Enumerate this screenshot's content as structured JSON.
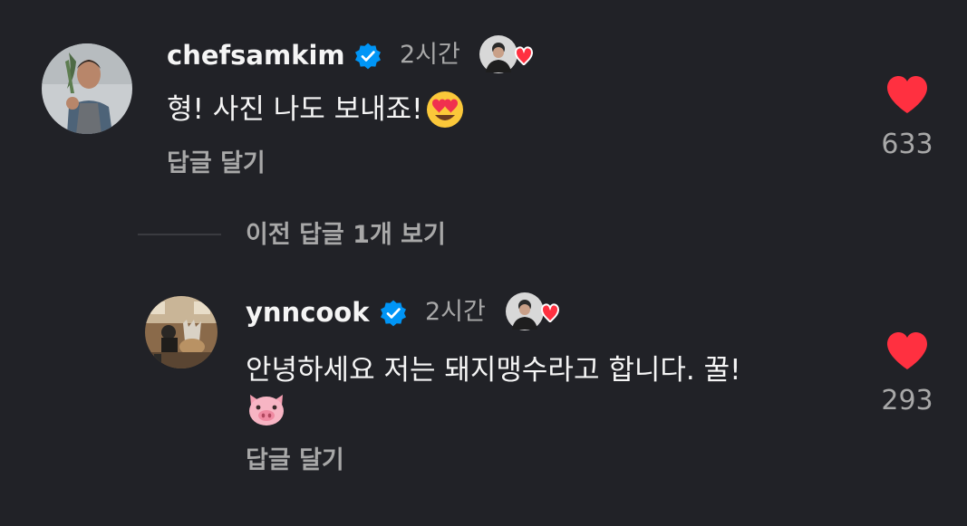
{
  "comments": [
    {
      "username": "chefsamkim",
      "verified": true,
      "time": "2시간",
      "text": "형! 사진 나도 보내죠!",
      "text_emoji": "heart-eyes-emoji",
      "reply_label": "답글 달기",
      "like_count": "633"
    },
    {
      "username": "ynncook",
      "verified": true,
      "time": "2시간",
      "text": "안녕하세요 저는 돼지맹수라고 합니다. 꿀!",
      "text_emoji": "pig-face-emoji",
      "reply_label": "답글 달기",
      "like_count": "293"
    }
  ],
  "view_previous_replies": "이전 답글 1개 보기",
  "colors": {
    "background": "#212227",
    "text_primary": "#f5f5f5",
    "text_secondary": "#a8a8a8",
    "verified_blue": "#0095f6",
    "like_red": "#ff3040"
  }
}
